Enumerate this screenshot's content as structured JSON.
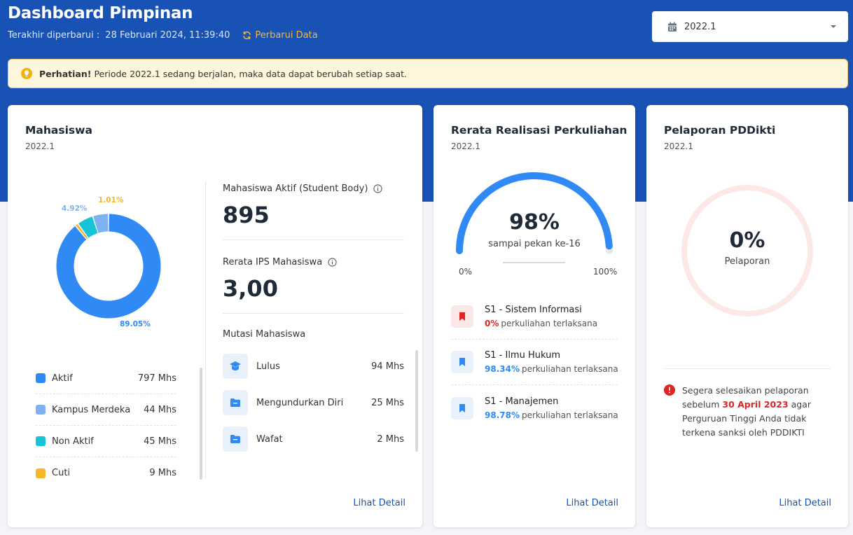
{
  "header": {
    "title": "Dashboard Pimpinan",
    "updated_label": "Terakhir diperbarui :",
    "updated_value": "28 Februari 2024, 11:39:40",
    "refresh_label": "Perbarui Data",
    "period_value": "2022.1"
  },
  "alert": {
    "bold": "Perhatian!",
    "text": "Periode 2022.1 sedang berjalan, maka data dapat berubah setiap saat."
  },
  "mahasiswa": {
    "title": "Mahasiswa",
    "period": "2022.1",
    "donut_labels": {
      "aktif": "89.05%",
      "kampus_merdeka": "4.92%",
      "cuti": "1.01%"
    },
    "legend": [
      {
        "name": "Aktif",
        "value": "797 Mhs",
        "color": "#2f8af5"
      },
      {
        "name": "Kampus Merdeka",
        "value": "44 Mhs",
        "color": "#7fb2f0"
      },
      {
        "name": "Non Aktif",
        "value": "45 Mhs",
        "color": "#17c3d6"
      },
      {
        "name": "Cuti",
        "value": "9 Mhs",
        "color": "#f8b62a"
      }
    ],
    "active_label": "Mahasiswa Aktif (Student Body)",
    "active_value": "895",
    "ips_label": "Rerata IPS Mahasiswa",
    "ips_value": "3,00",
    "mutasi_title": "Mutasi Mahasiswa",
    "mutasi": [
      {
        "name": "Lulus",
        "value": "94 Mhs",
        "icon": "graduation-cap-icon"
      },
      {
        "name": "Mengundurkan Diri",
        "value": "25 Mhs",
        "icon": "folder-icon"
      },
      {
        "name": "Wafat",
        "value": "2 Mhs",
        "icon": "folder-icon"
      }
    ],
    "detail_label": "Lihat Detail"
  },
  "perkuliahan": {
    "title": "Rerata Realisasi Perkuliahan",
    "period": "2022.1",
    "gauge_value": 98,
    "gauge_label": "98%",
    "gauge_sub": "sampai pekan ke-16",
    "gauge_min": "0%",
    "gauge_max": "100%",
    "prodi": [
      {
        "name": "S1 - Sistem Informasi",
        "pct": "0%",
        "suffix": "perkuliahan terlaksana",
        "color": "#e02424",
        "icon_bg": "#fde8e8"
      },
      {
        "name": "S1 - Ilmu Hukum",
        "pct": "98.34%",
        "suffix": "perkuliahan terlaksana",
        "color": "#2f8af5",
        "icon_bg": "#e7f0fb"
      },
      {
        "name": "S1 - Manajemen",
        "pct": "98.78%",
        "suffix": "perkuliahan terlaksana",
        "color": "#2f8af5",
        "icon_bg": "#e7f0fb"
      }
    ],
    "detail_label": "Lihat Detail"
  },
  "pelaporan": {
    "title": "Pelaporan PDDikti",
    "period": "2022.1",
    "ring_value": 0,
    "ring_label": "0%",
    "ring_sub": "Pelaporan",
    "warn_prefix": "Segera selesaikan pelaporan sebelum",
    "warn_date": "30 April 2023",
    "warn_suffix": "agar Perguruan Tinggi Anda tidak terkena sanksi oleh PDDIKTI",
    "detail_label": "Lihat Detail"
  }
}
